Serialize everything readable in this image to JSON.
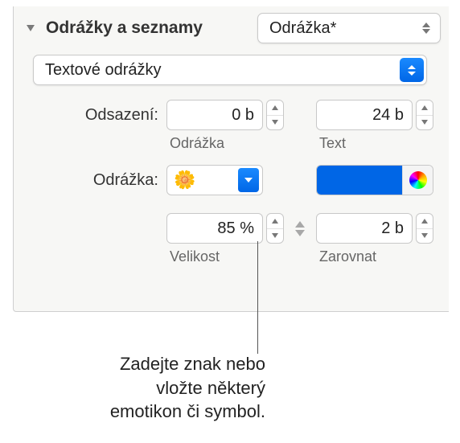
{
  "section": {
    "title": "Odrážky a seznamy"
  },
  "style_popup": {
    "value": "Odrážka*"
  },
  "type_popup": {
    "value": "Textové odrážky"
  },
  "indent": {
    "label": "Odsazení:",
    "bullet_value": "0 b",
    "bullet_sublabel": "Odrážka",
    "text_value": "24 b",
    "text_sublabel": "Text"
  },
  "bullet": {
    "label": "Odrážka:",
    "char": "🌼",
    "color": "#0066e6"
  },
  "size": {
    "value": "85 %",
    "sublabel": "Velikost"
  },
  "align": {
    "value": "2 b",
    "sublabel": "Zarovnat"
  },
  "callout": "Zadejte znak nebo vložte některý emotikon či symbol."
}
